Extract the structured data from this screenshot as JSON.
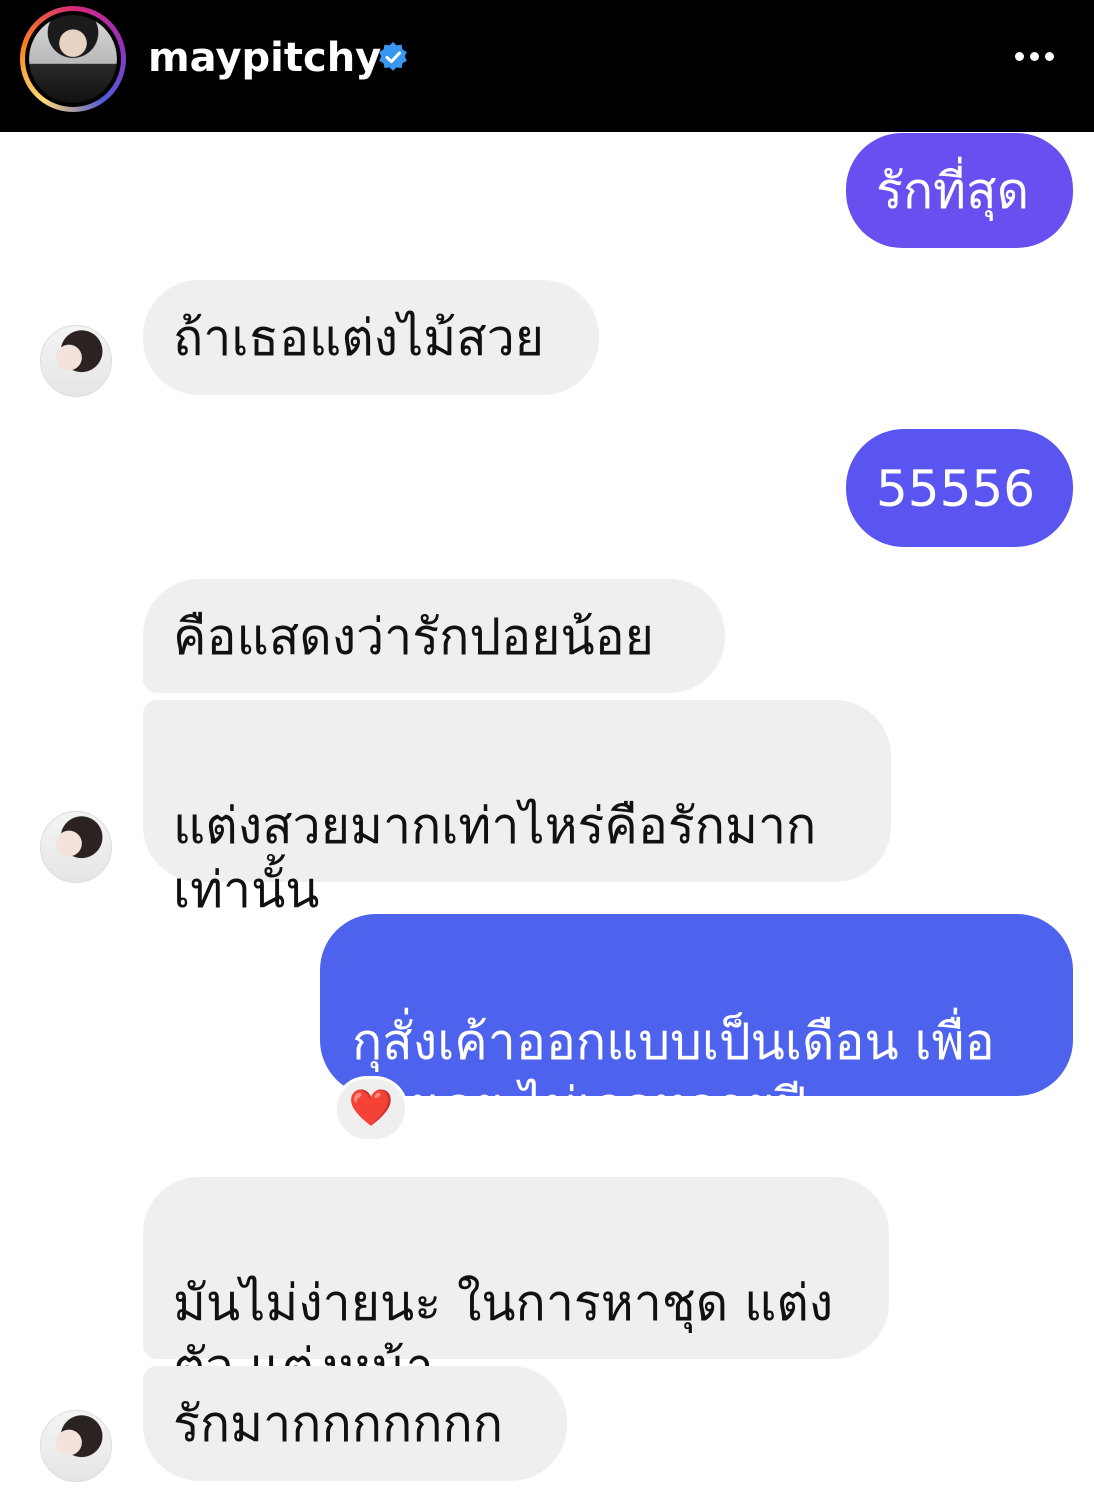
{
  "header": {
    "username": "maypitchy",
    "verified_color": "#3897f0",
    "more_icon": "more-horizontal-icon"
  },
  "messages": [
    {
      "direction": "outgoing",
      "text": "รักที่สุด",
      "color": "#6a4ff0"
    },
    {
      "direction": "incoming",
      "text": "ถ้าเธอแต่งไม้สวย"
    },
    {
      "direction": "outgoing",
      "text": "55556",
      "color": "#5a55f0"
    },
    {
      "direction": "incoming",
      "text": "คือแสดงว่ารักปอยน้อย"
    },
    {
      "direction": "incoming",
      "text": "แต่งสวยมากเท่าไหร่คือรักมาก\nเท่านั้น"
    },
    {
      "direction": "outgoing",
      "text": "กุสั่งเค้าออกแบบเป็นเดือน เพื่อ\nเมิงเลย ไม่เจอหลายปี",
      "color": "#4d63ee",
      "reaction": "❤️"
    },
    {
      "direction": "incoming",
      "text": "มันไม่ง่ายนะ ในการหาชุด แต่ง\nตัว แต่งหน้า"
    },
    {
      "direction": "incoming",
      "text": "รักมากกกกกกก"
    }
  ]
}
